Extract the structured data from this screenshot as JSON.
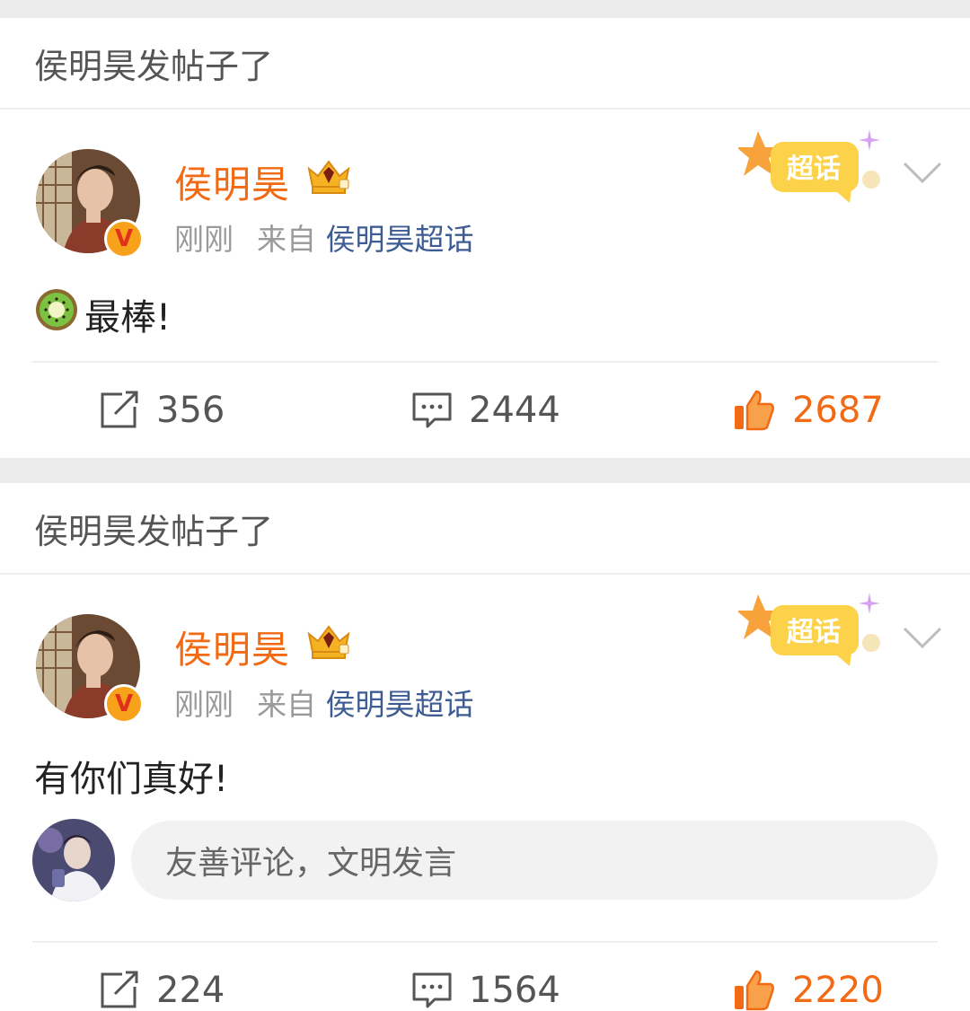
{
  "posts": [
    {
      "header": "侯明昊发帖子了",
      "username": "侯明昊",
      "time": "刚刚",
      "from_prefix": "来自",
      "source": "侯明昊超话",
      "chaohua_label": "超话",
      "text": "最棒!",
      "has_kiwi_emoji": true,
      "reposts": "356",
      "comments": "2444",
      "likes": "2687"
    },
    {
      "header": "侯明昊发帖子了",
      "username": "侯明昊",
      "time": "刚刚",
      "from_prefix": "来自",
      "source": "侯明昊超话",
      "chaohua_label": "超话",
      "text": "有你们真好!",
      "has_kiwi_emoji": false,
      "comment_placeholder": "友善评论，文明发言",
      "reposts": "224",
      "comments": "1564",
      "likes": "2220"
    }
  ],
  "icons": {
    "verified": "V",
    "repost": "repost-icon",
    "comment": "comment-icon",
    "like": "thumbs-up-icon",
    "chevron": "chevron-down-icon",
    "crown": "crown-icon"
  },
  "colors": {
    "username": "#f26a13",
    "source_link": "#3d5c94",
    "like": "#f26a13",
    "verified_badge": "#f7a21a"
  }
}
